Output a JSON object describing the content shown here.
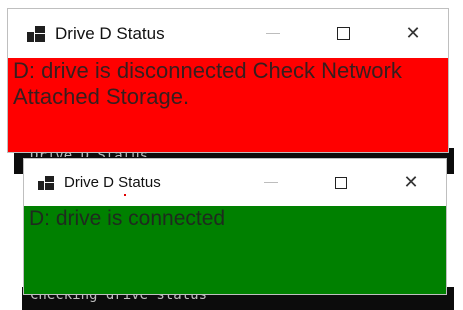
{
  "background_console": {
    "line_top": "Drive D Status",
    "line_bottom": "Checking drive status"
  },
  "windows": [
    {
      "title": "Drive D Status",
      "message": "D: drive is disconnected Check Network Attached Storage.",
      "content_color": "#ff0000",
      "state": "disconnected"
    },
    {
      "title": "Drive D Status",
      "message": "D: drive is connected",
      "content_color": "#008000",
      "state": "connected"
    }
  ],
  "icons": {
    "app": "windows-form-icon",
    "minimize": "minimize-icon",
    "maximize": "maximize-icon",
    "close": "close-icon"
  },
  "caption_glyphs": {
    "close": "✕"
  }
}
